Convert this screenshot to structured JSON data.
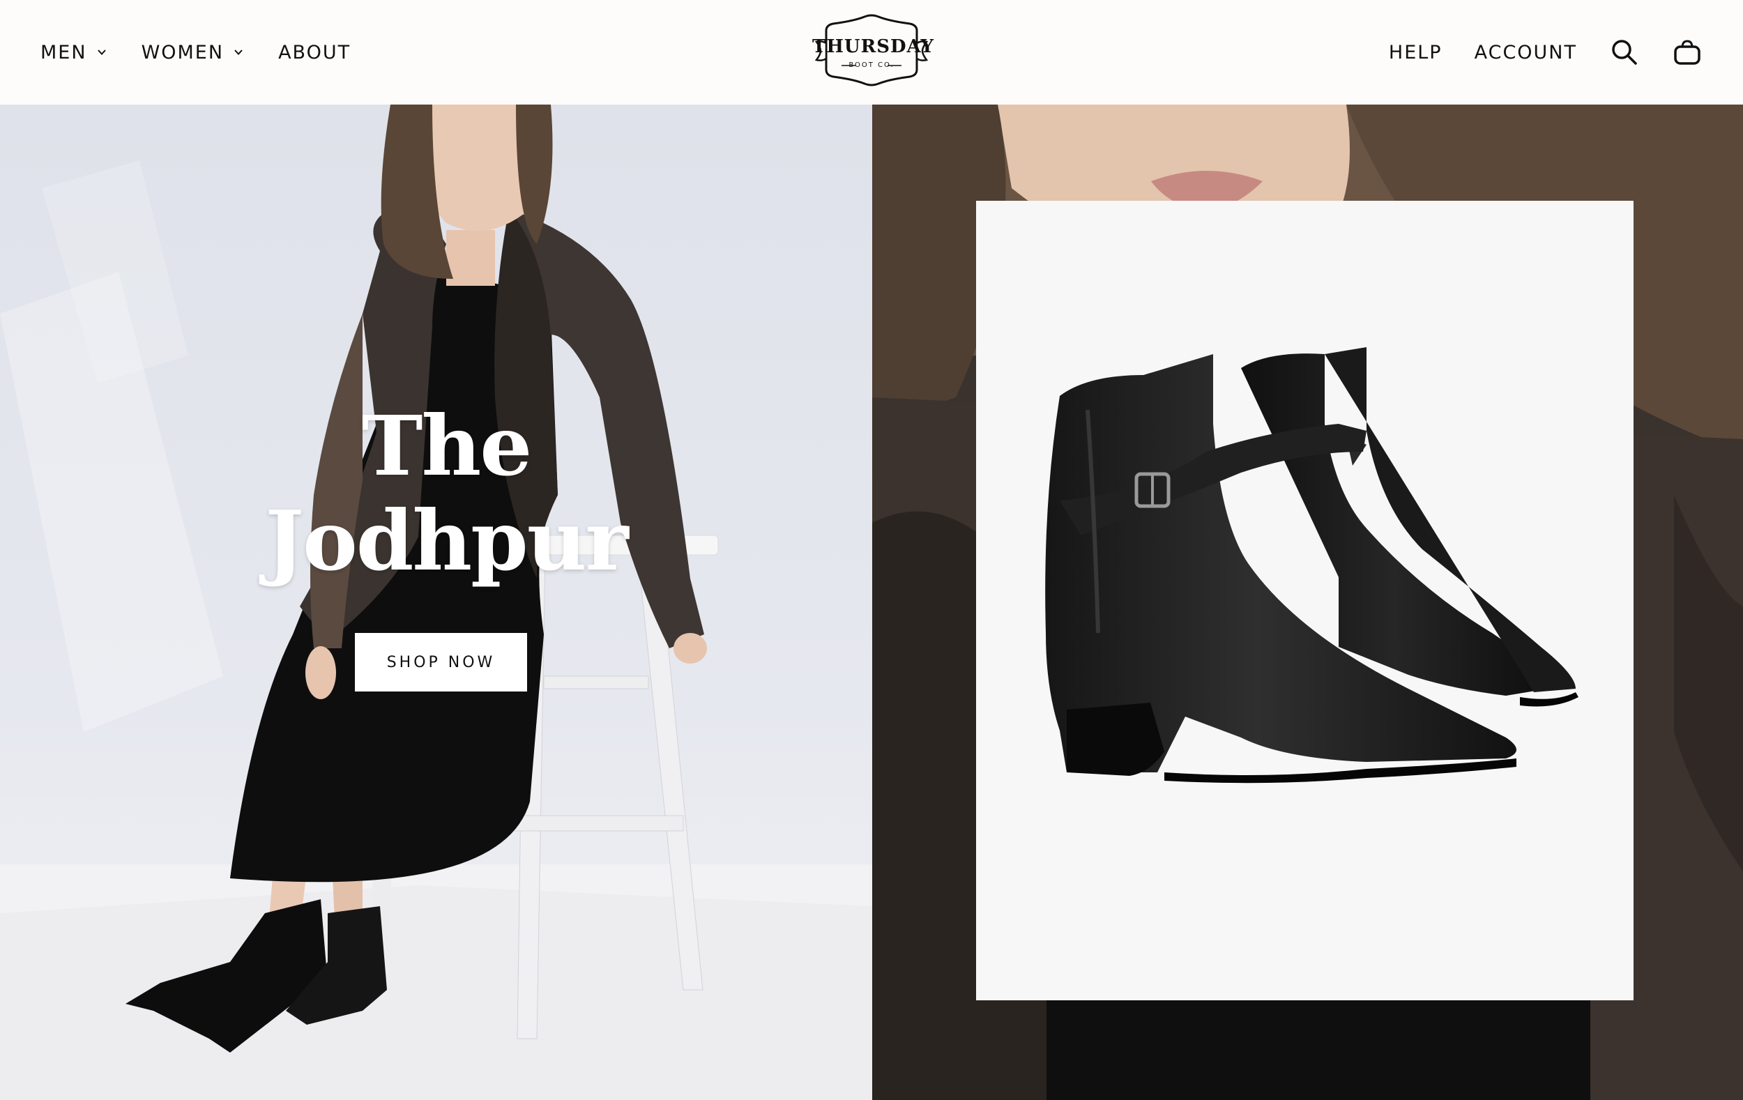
{
  "header": {
    "nav_left": [
      {
        "label": "MEN",
        "has_dropdown": true
      },
      {
        "label": "WOMEN",
        "has_dropdown": true
      },
      {
        "label": "ABOUT",
        "has_dropdown": false
      }
    ],
    "logo": {
      "wordmark": "THURSDAY",
      "subline": "BOOT CO."
    },
    "nav_right": [
      {
        "label": "HELP"
      },
      {
        "label": "ACCOUNT"
      }
    ],
    "icons": [
      "search-icon",
      "cart-icon"
    ]
  },
  "hero": {
    "headline_line1": "The",
    "headline_line2": "Jodhpur",
    "cta_label": "SHOP NOW"
  },
  "colors": {
    "header_bg": "#fdfcfb",
    "text_dark": "#111111",
    "headline": "#ffffff",
    "card_bg": "#f7f7f7"
  }
}
